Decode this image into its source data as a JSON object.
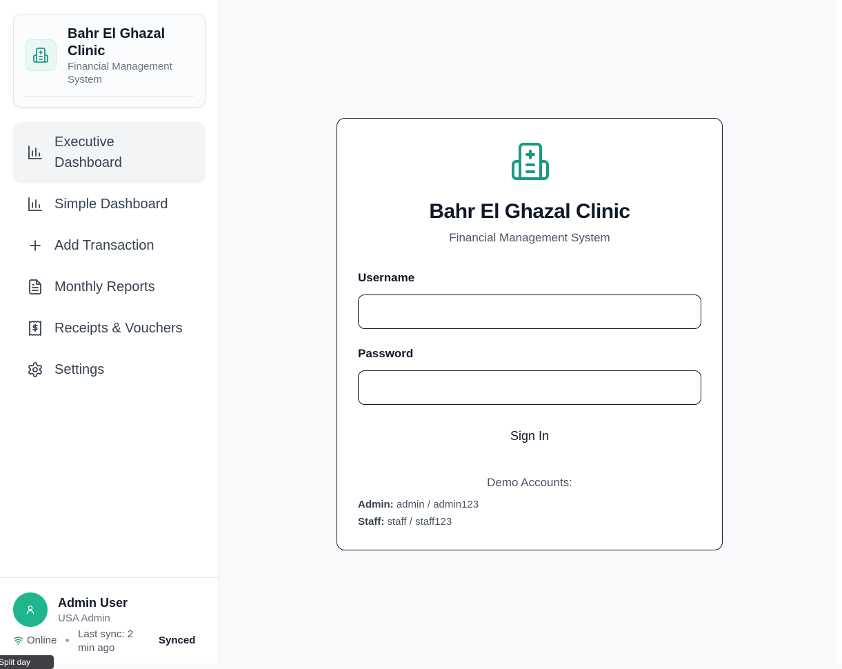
{
  "sidebar": {
    "brand": {
      "title": "Bahr El Ghazal Clinic",
      "subtitle": "Financial Management System",
      "icon": "hospital-icon"
    },
    "items": [
      {
        "label": "Executive Dashboard",
        "icon": "bar-chart-icon",
        "active": true
      },
      {
        "label": "Simple Dashboard",
        "icon": "bar-chart-icon",
        "active": false
      },
      {
        "label": "Add Transaction",
        "icon": "plus-icon",
        "active": false
      },
      {
        "label": "Monthly Reports",
        "icon": "file-text-icon",
        "active": false
      },
      {
        "label": "Receipts & Vouchers",
        "icon": "receipt-icon",
        "active": false
      },
      {
        "label": "Settings",
        "icon": "gear-icon",
        "active": false
      }
    ],
    "footer": {
      "user_name": "Admin User",
      "user_role": "USA Admin",
      "status": "Online",
      "last_sync": "Last sync: 2 min ago",
      "sync_state": "Synced"
    },
    "tooltip": "Split day"
  },
  "login": {
    "title": "Bahr El Ghazal Clinic",
    "subtitle": "Financial Management System",
    "username_label": "Username",
    "username_value": "",
    "password_label": "Password",
    "password_value": "",
    "signin_label": "Sign In",
    "demo_title": "Demo Accounts:",
    "demo": [
      {
        "role": "Admin:",
        "credentials": "admin / admin123"
      },
      {
        "role": "Staff:",
        "credentials": "staff / staff123"
      }
    ]
  },
  "colors": {
    "accent": "#1a9a85",
    "avatar": "#1fb58f",
    "online": "#22a05a"
  }
}
